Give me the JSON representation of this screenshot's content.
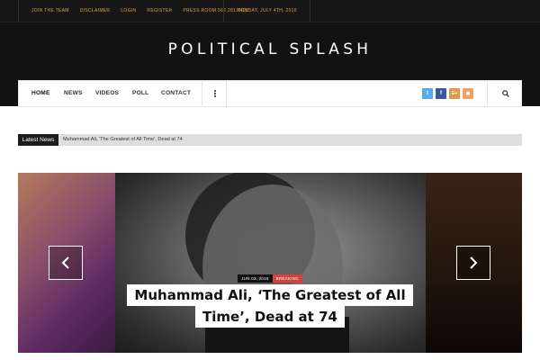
{
  "topbar": {
    "links": [
      "JOIN THE TEAM",
      "DISCLAIMER",
      "LOGIN",
      "REGISTER",
      "PRESS ROOM 562.281.7492"
    ],
    "date": "MONDAY, JULY 4TH, 2016"
  },
  "site": {
    "title": "POLITICAL SPLASH"
  },
  "nav": {
    "items": [
      "HOME",
      "NEWS",
      "VIDEOS",
      "POLL",
      "CONTACT"
    ],
    "active": "HOME",
    "social": [
      {
        "name": "twitter-icon",
        "glyph": "t",
        "color": "#55acee"
      },
      {
        "name": "facebook-icon",
        "glyph": "f",
        "color": "#3b5998"
      },
      {
        "name": "google-plus-icon",
        "glyph": "G+",
        "color": "#dd9a4a"
      },
      {
        "name": "rss-icon",
        "glyph": "◉",
        "color": "#f0a06a"
      }
    ]
  },
  "ticker": {
    "label": "Latest News",
    "headline": "Muhammad Ali, 'The Greatest of All Time', Dead at 74"
  },
  "slider": {
    "date": "JUN 03, 2016",
    "category": "BREAKING",
    "title_line1": "Muhammad Ali, ‘The Greatest of All",
    "title_line2": "Time’, Dead at 74",
    "prev_icon": "chevron-left-icon",
    "next_icon": "chevron-right-icon"
  }
}
